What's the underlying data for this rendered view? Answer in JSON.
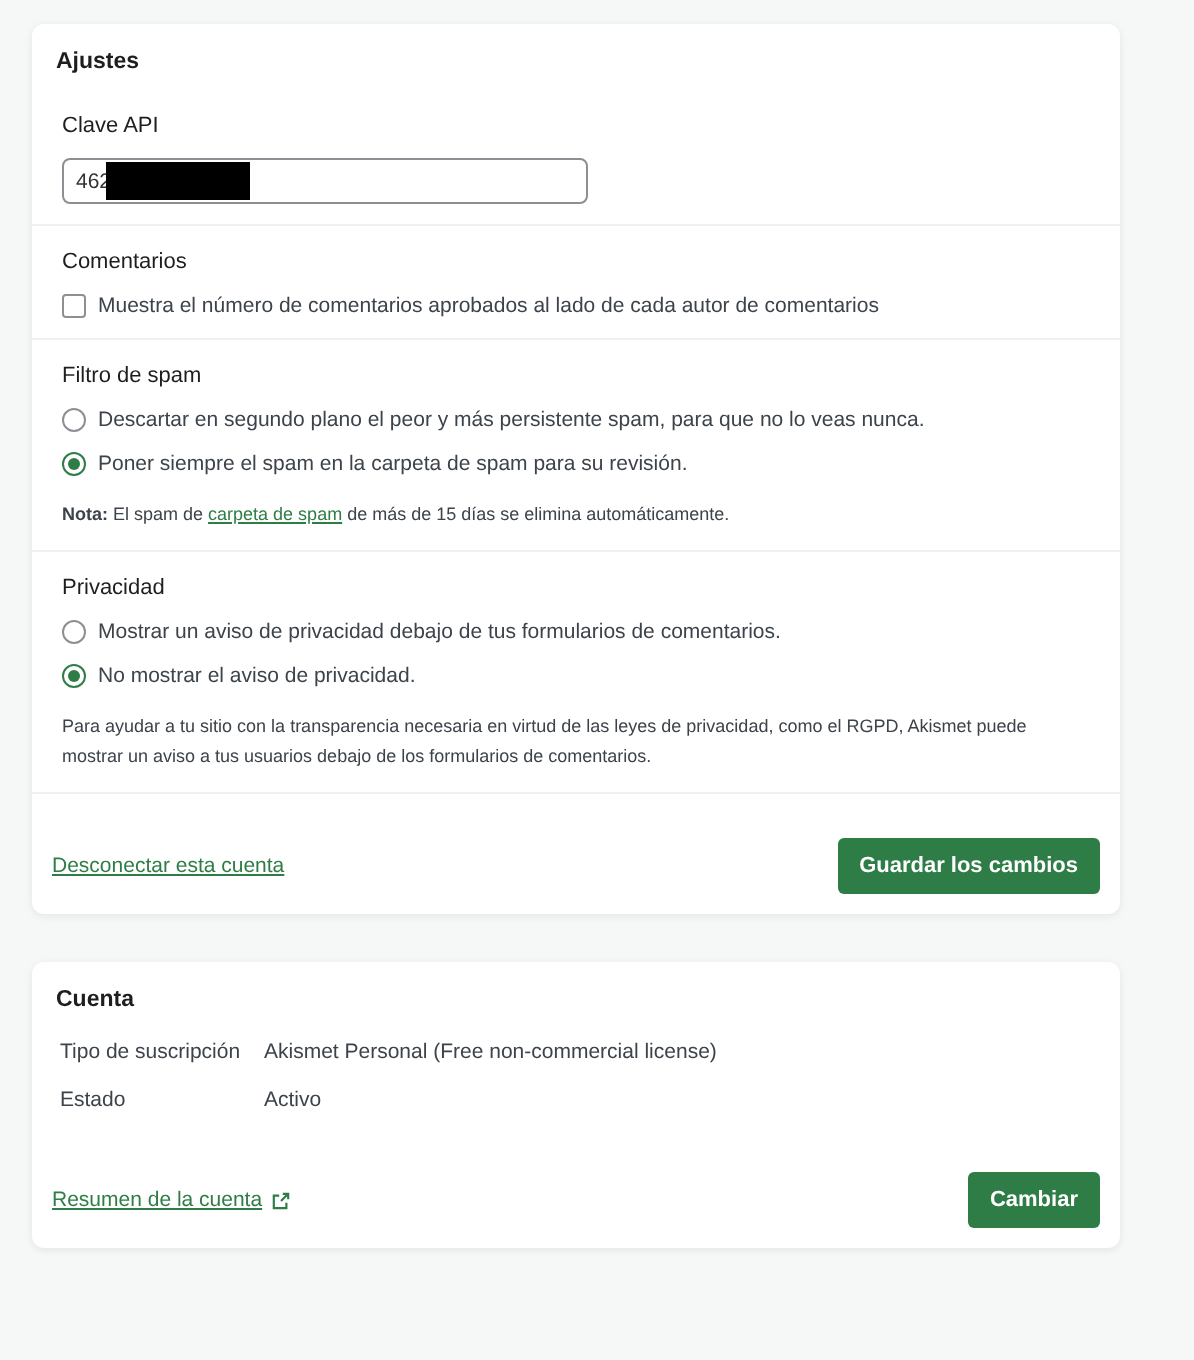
{
  "settings": {
    "title": "Ajustes",
    "api_key": {
      "label": "Clave API",
      "value": "462",
      "redacted": true
    },
    "comments": {
      "title": "Comentarios",
      "option": {
        "label": "Muestra el número de comentarios aprobados al lado de cada autor de comentarios",
        "checked": false
      }
    },
    "spam": {
      "title": "Filtro de spam",
      "options": [
        {
          "label": "Descartar en segundo plano el peor y más persistente spam, para que no lo veas nunca.",
          "selected": false
        },
        {
          "label": "Poner siempre el spam en la carpeta de spam para su revisión.",
          "selected": true
        }
      ],
      "note": {
        "prefix": "**Nota:** El spam de ",
        "link": "carpeta de spam",
        "suffix": " de más de 15 días se elimina automáticamente."
      }
    },
    "privacy": {
      "title": "Privacidad",
      "options": [
        {
          "label": "Mostrar un aviso de privacidad debajo de tus formularios de comentarios.",
          "selected": false
        },
        {
          "label": "No mostrar el aviso de privacidad.",
          "selected": true
        }
      ],
      "help": "Para ayudar a tu sitio con la transparencia necesaria en virtud de las leyes de privacidad, como el RGPD, Akismet puede mostrar un aviso a tus usuarios debajo de los formularios de comentarios."
    },
    "disconnect_link": "Desconectar esta cuenta",
    "save_button": "Guardar los cambios"
  },
  "account": {
    "title": "Cuenta",
    "rows": [
      {
        "label": "Tipo de suscripción",
        "value": "Akismet Personal (Free non-commercial license)"
      },
      {
        "label": "Estado",
        "value": "Activo"
      }
    ],
    "summary_link": "Resumen de la cuenta",
    "change_button": "Cambiar"
  }
}
